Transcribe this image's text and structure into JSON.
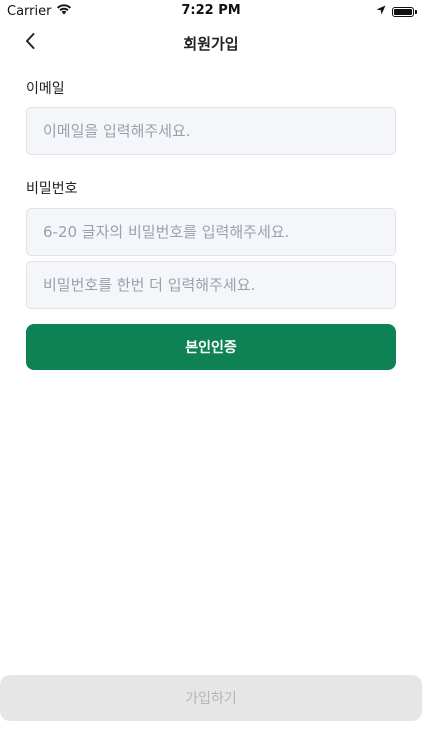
{
  "status_bar": {
    "carrier": "Carrier",
    "time": "7:22 PM",
    "icons": [
      "wifi-icon",
      "location-arrow-icon",
      "battery-icon"
    ]
  },
  "nav": {
    "title": "회원가입",
    "back_icon": "chevron-left-icon"
  },
  "form": {
    "email": {
      "label": "이메일",
      "placeholder": "이메일을 입력해주세요.",
      "value": ""
    },
    "password": {
      "label": "비밀번호",
      "placeholder": "6-20 글자의 비밀번호를 입력해주세요.",
      "value": ""
    },
    "password_confirm": {
      "placeholder": "비밀번호를 한번 더 입력해주세요.",
      "value": ""
    },
    "verify_button_label": "본인인증"
  },
  "footer": {
    "signup_button_label": "가입하기",
    "signup_enabled": false
  },
  "colors": {
    "accent": "#0f8255",
    "field_background": "#f5f6fa",
    "field_border": "#e1e3ea",
    "disabled_button_bg": "#e6e6e6",
    "disabled_button_text": "#b5b5b5"
  }
}
